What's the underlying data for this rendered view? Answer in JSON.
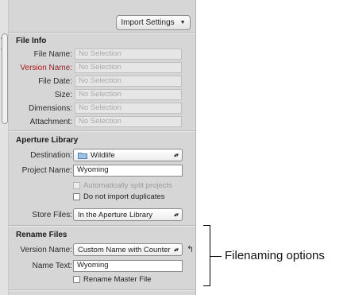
{
  "toolbar": {
    "import_settings_label": "Import Settings"
  },
  "file_info": {
    "title": "File Info",
    "rows": [
      {
        "label": "File Name:",
        "value": "No Selection"
      },
      {
        "label": "Version Name:",
        "value": "No Selection"
      },
      {
        "label": "File Date:",
        "value": "No Selection"
      },
      {
        "label": "Size:",
        "value": "No Selection"
      },
      {
        "label": "Dimensions:",
        "value": "No Selection"
      },
      {
        "label": "Attachment:",
        "value": "No Selection"
      }
    ]
  },
  "aperture_library": {
    "title": "Aperture Library",
    "destination_label": "Destination:",
    "destination_value": "Wildlife",
    "project_name_label": "Project Name:",
    "project_name_value": "Wyoming",
    "split_projects_label": "Automatically split projects",
    "no_duplicates_label": "Do not import duplicates",
    "store_files_label": "Store Files:",
    "store_files_value": "In the Aperture Library"
  },
  "rename_files": {
    "title": "Rename Files",
    "version_name_label": "Version Name:",
    "version_name_value": "Custom Name with Counter",
    "name_text_label": "Name Text:",
    "name_text_value": "Wyoming",
    "rename_master_label": "Rename Master File"
  },
  "callout": {
    "text": "Filenaming options"
  },
  "colors": {
    "panel_bg": "#d6d6d6",
    "version_label_red": "#9b1b1b"
  }
}
